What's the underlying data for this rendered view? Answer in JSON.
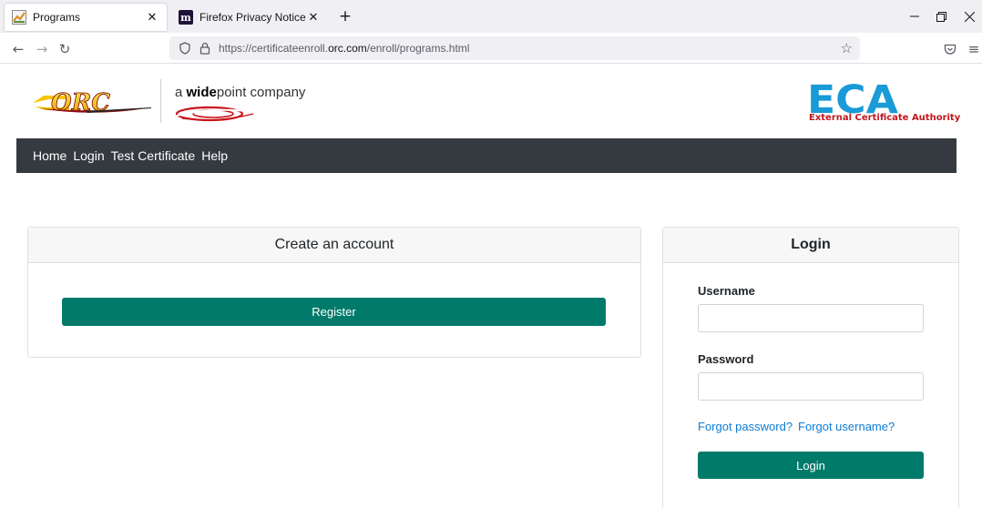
{
  "browser": {
    "tabs": [
      {
        "title": "Programs",
        "active": true
      },
      {
        "title": "Firefox Privacy Notice — Mozill",
        "active": false
      }
    ],
    "new_tab": "+",
    "window_controls": {
      "minimize": "—",
      "restore": "❐",
      "close": "✕"
    },
    "url": {
      "prefix": "https://certificateenroll.",
      "host": "orc.com",
      "path": "/enroll/programs.html"
    },
    "icons": {
      "back": "←",
      "forward": "→",
      "reload": "↻",
      "star": "☆",
      "pocket": "pocket-icon",
      "menu": "≡"
    }
  },
  "header": {
    "orc_logo_text": "ORC",
    "tagline": {
      "a": "a ",
      "wide": "wide",
      "rest": "point company"
    },
    "eca_logo_text": "ECA",
    "eca_subtitle": "External Certificate Authority"
  },
  "nav": {
    "items": [
      "Home",
      "Login",
      "Test Certificate",
      "Help"
    ]
  },
  "create_account": {
    "title": "Create an account",
    "register_label": "Register"
  },
  "login": {
    "title": "Login",
    "username_label": "Username",
    "password_label": "Password",
    "username_value": "",
    "password_value": "",
    "forgot_password": "Forgot password?",
    "forgot_username": "Forgot username?",
    "submit_label": "Login"
  },
  "colors": {
    "accent": "#007b6b",
    "nav_bg": "#343a40",
    "link": "#0c7cd5",
    "eca_blue": "#1a9ad6",
    "eca_red": "#c0171d"
  }
}
